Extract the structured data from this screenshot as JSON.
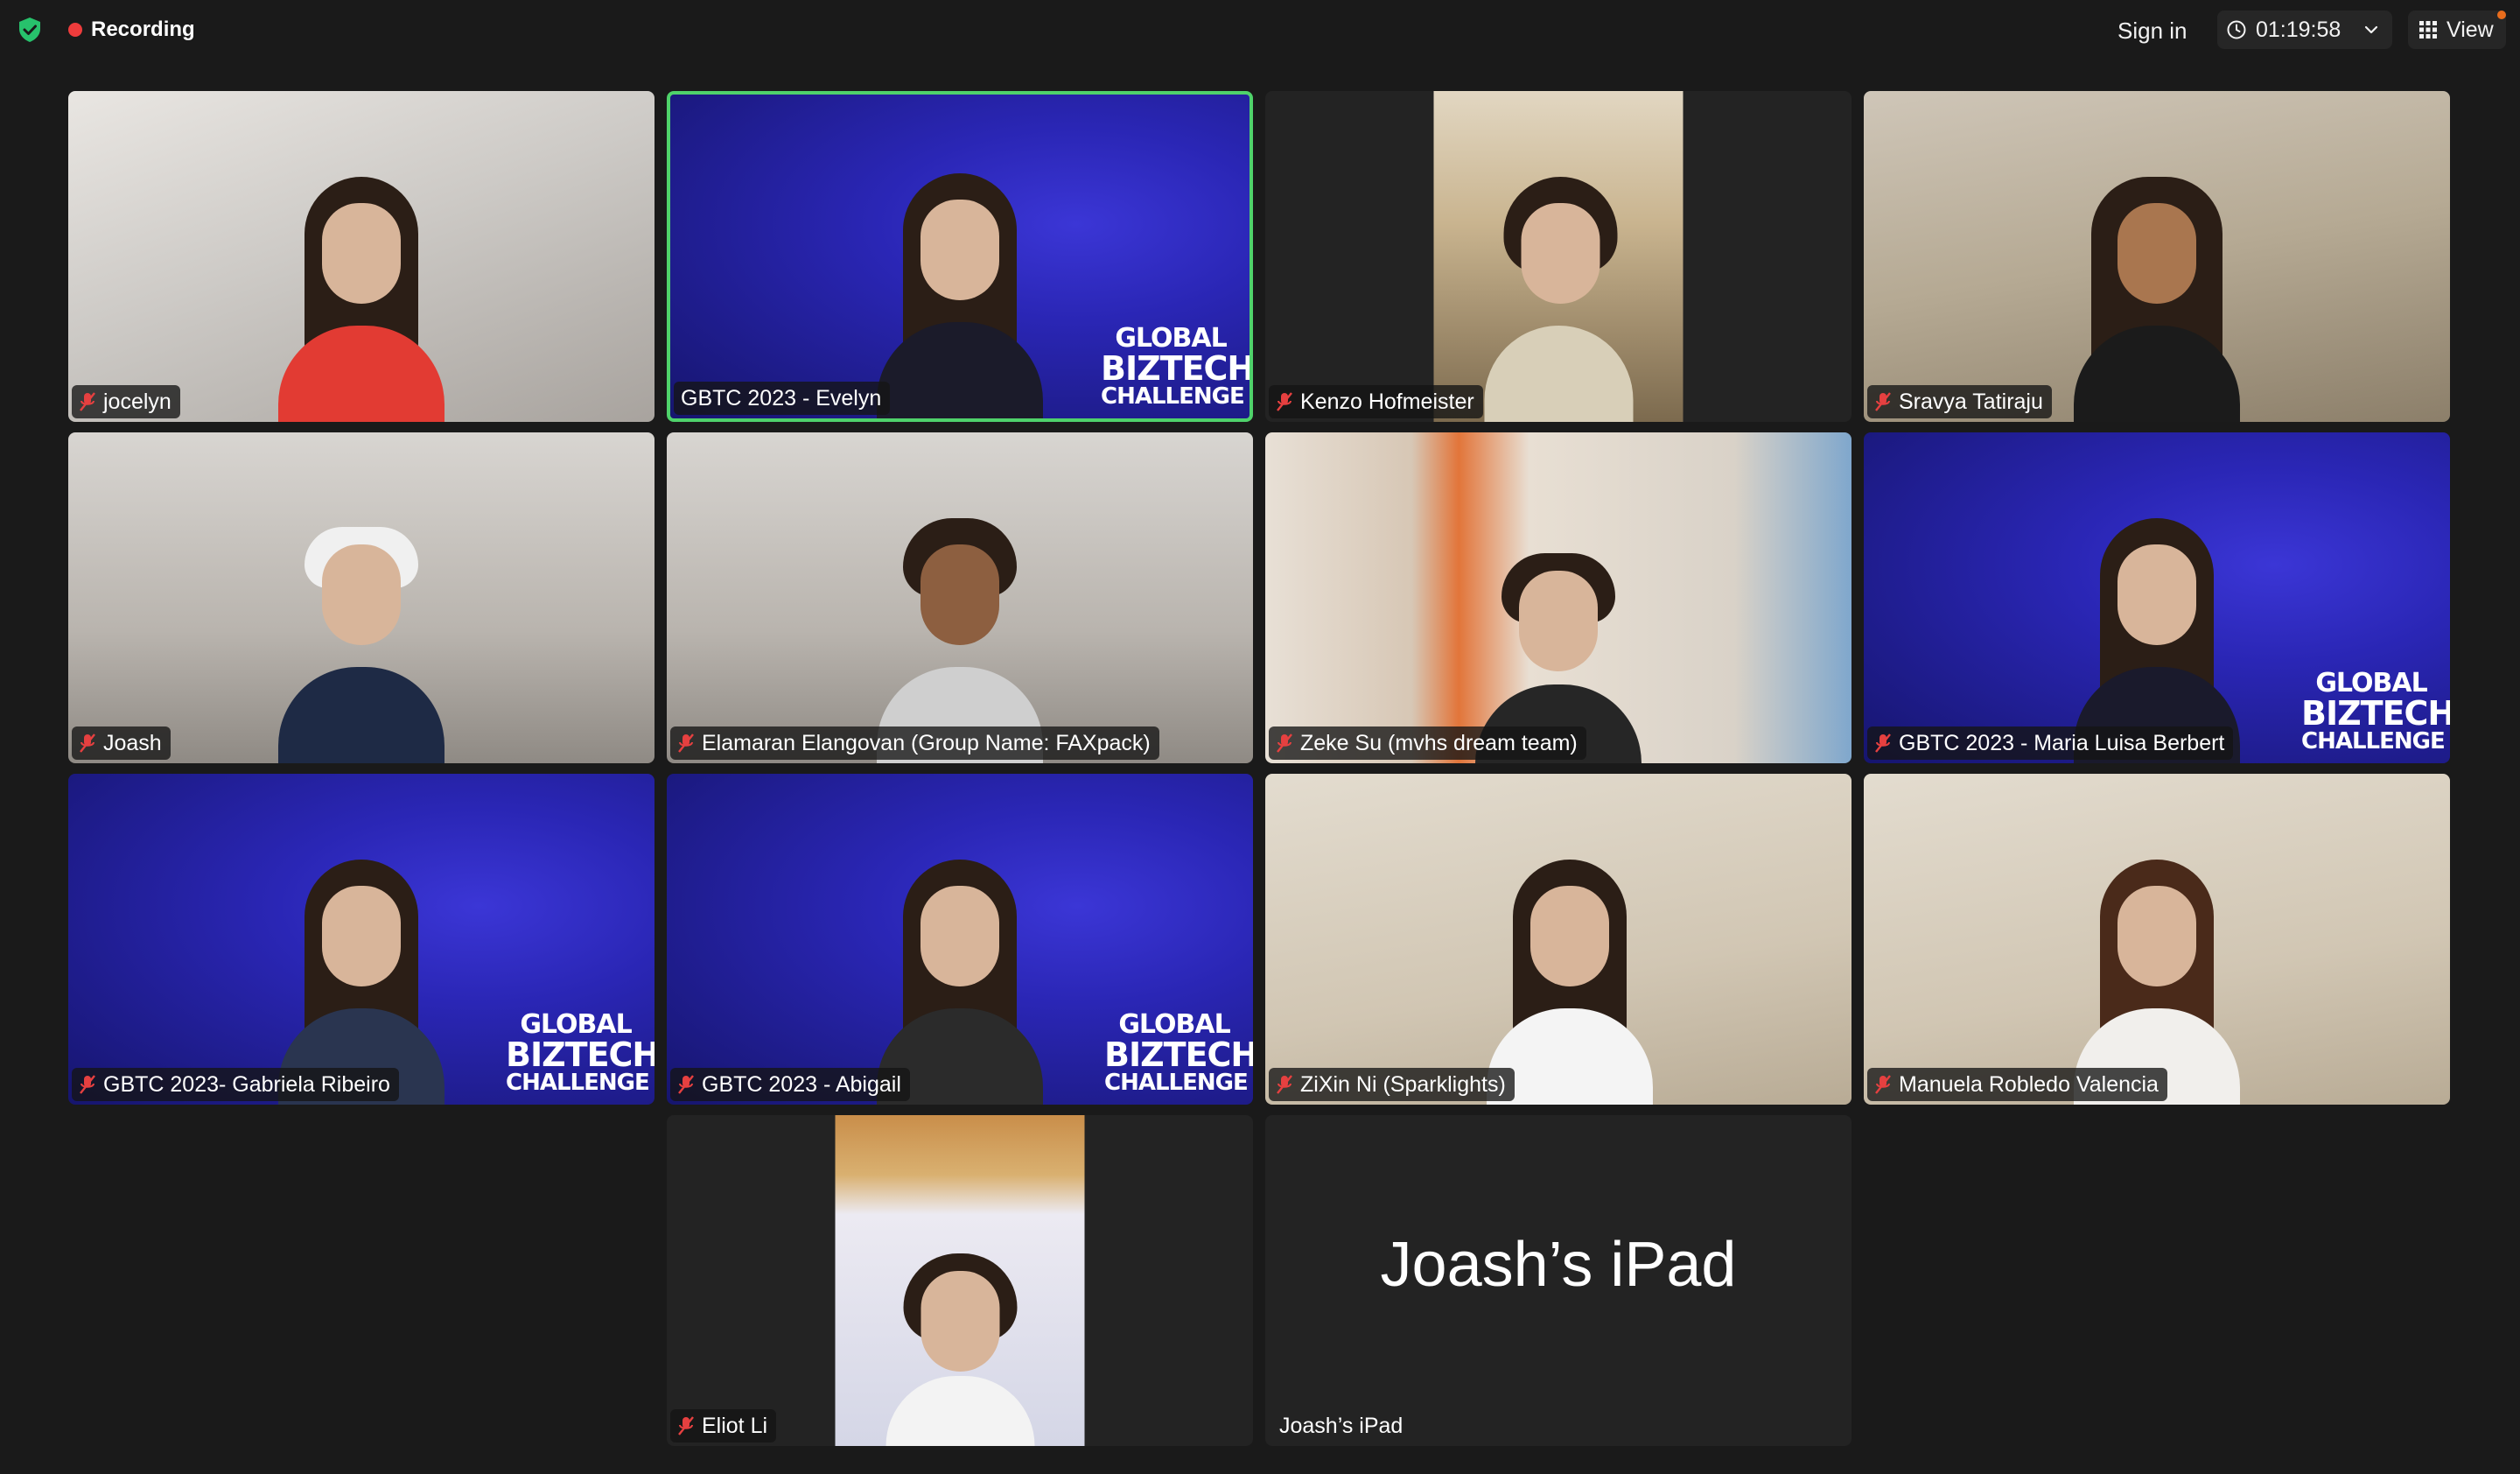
{
  "topbar": {
    "recording_label": "Recording",
    "sign_in_label": "Sign in",
    "timer": "01:19:58",
    "view_label": "View",
    "colors": {
      "recording_dot": "#ee3c3c",
      "shield": "#27c26c",
      "notification_badge": "#e86c1c"
    },
    "icons": [
      "shield-check-icon",
      "clock-icon",
      "chevron-down-icon",
      "grid-icon"
    ]
  },
  "meeting": {
    "active_speaker_color": "#4fd26b",
    "virtual_background_logo": {
      "line1": "GLOBAL",
      "line2": "BIZTECH",
      "line3": "CHALLENGE"
    },
    "participants": [
      {
        "name": "jocelyn",
        "muted": true
      },
      {
        "name": "GBTC 2023 - Evelyn",
        "muted": false,
        "active_speaker": true
      },
      {
        "name": "Kenzo Hofmeister",
        "muted": true
      },
      {
        "name": "Sravya Tatiraju",
        "muted": true
      },
      {
        "name": "Joash",
        "muted": true
      },
      {
        "name": "Elamaran Elangovan (Group Name: FAXpack)",
        "muted": true
      },
      {
        "name": "Zeke Su (mvhs dream team)",
        "muted": true
      },
      {
        "name": "GBTC 2023 - Maria Luisa Berbert",
        "muted": true
      },
      {
        "name": "GBTC 2023- Gabriela Ribeiro",
        "muted": true
      },
      {
        "name": "GBTC 2023 - Abigail",
        "muted": true
      },
      {
        "name": "ZiXin Ni (Sparklights)",
        "muted": true
      },
      {
        "name": "Manuela Robledo Valencia",
        "muted": true
      },
      {
        "name": "Eliot Li",
        "muted": true
      },
      {
        "name": "Joash’s iPad",
        "muted": false,
        "video_off": true,
        "display_text": "Joash’s iPad"
      }
    ]
  }
}
